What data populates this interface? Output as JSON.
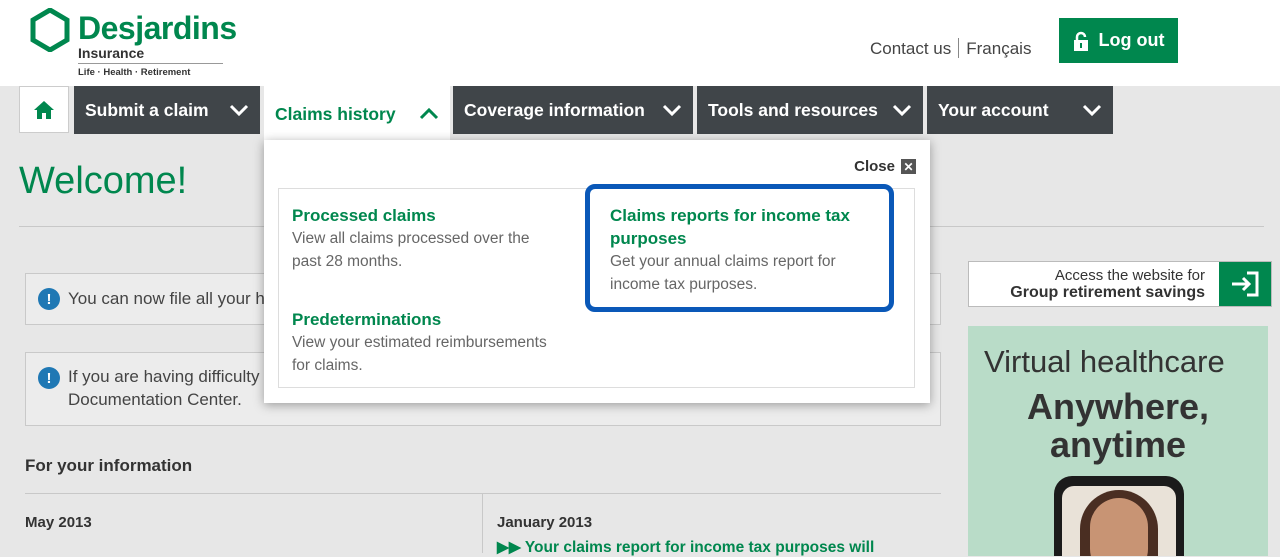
{
  "brand": {
    "name": "Desjardins",
    "sub": "Insurance",
    "tagline": "Life · Health · Retirement",
    "color": "#00874e"
  },
  "header": {
    "contact": "Contact us",
    "language": "Français",
    "logout": "Log out"
  },
  "nav": {
    "home_icon": "home-icon",
    "items": [
      {
        "label": "Submit a claim"
      },
      {
        "label": "Claims history"
      },
      {
        "label": "Coverage information"
      },
      {
        "label": "Tools and resources"
      },
      {
        "label": "Your account"
      }
    ]
  },
  "main": {
    "welcome": "Welcome!",
    "notice1": "You can now file all your h",
    "notice2_line1": "If you are having difficulty",
    "notice2_line2": "Documentation Center.",
    "fyi_title": "For your information",
    "month_left": "May 2013",
    "month_right": "January 2013",
    "news_link": "▶▶ Your claims report for income tax purposes will"
  },
  "dropdown": {
    "close": "Close",
    "items": [
      {
        "title": "Processed claims",
        "desc": "View all claims processed over the past 28 months."
      },
      {
        "title": "Claims reports for income tax purposes",
        "desc": "Get your annual claims report for income tax purposes."
      },
      {
        "title": "Predeterminations",
        "desc": "View your estimated reimbursements for claims."
      }
    ],
    "highlight_color": "#0a58b8"
  },
  "sidebar": {
    "grs_line1": "Access the website for",
    "grs_line2": "Group retirement savings",
    "promo_line1": "Virtual healthcare",
    "promo_line2": "Anywhere,",
    "promo_line3": "anytime"
  }
}
